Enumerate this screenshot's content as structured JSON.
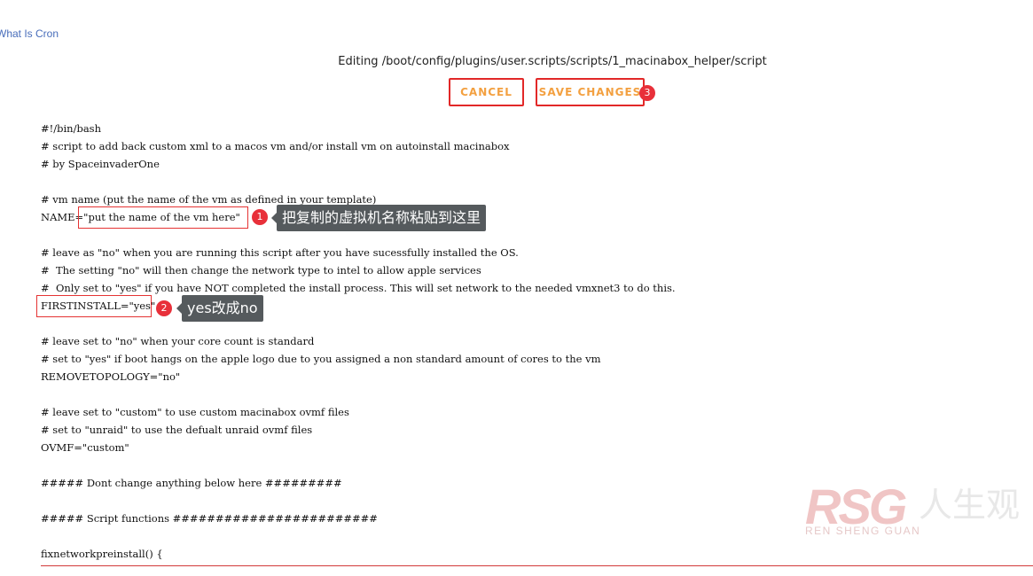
{
  "header": {
    "link_text": "What Is Cron",
    "editing_title": "Editing /boot/config/plugins/user.scripts/scripts/1_macinabox_helper/script"
  },
  "toolbar": {
    "cancel_label": "CANCEL",
    "save_label": "SAVE CHANGES"
  },
  "editor": {
    "lines": [
      "#!/bin/bash",
      "# script to add back custom xml to a macos vm and/or install vm on autoinstall macinabox",
      "# by SpaceinvaderOne",
      "",
      "# vm name (put the name of the vm as defined in your template)",
      "NAME=\"put the name of the vm here\"",
      "",
      "# leave as \"no\" when you are running this script after you have sucessfully installed the OS.",
      "#  The setting \"no\" will then change the network type to intel to allow apple services",
      "#  Only set to \"yes\" if you have NOT completed the install process. This will set network to the needed vmxnet3 to do this.",
      "FIRSTINSTALL=\"yes\"",
      "",
      "# leave set to \"no\" when your core count is standard",
      "# set to \"yes\" if boot hangs on the apple logo due to you assigned a non standard amount of cores to the vm",
      "REMOVETOPOLOGY=\"no\"",
      "",
      "# leave set to \"custom\" to use custom macinabox ovmf files",
      "# set to \"unraid\" to use the defualt unraid ovmf files",
      "OVMF=\"custom\"",
      "",
      "##### Dont change anything below here #########",
      "",
      "##### Script functions ########################",
      "",
      "fixnetworkpreinstall() {"
    ]
  },
  "annotations": {
    "badge_1": "1",
    "tip_1": "把复制的虚拟机名称粘贴到这里",
    "badge_2": "2",
    "tip_2": "yes改成no",
    "badge_3": "3"
  },
  "watermark": {
    "logo_text": "RSG",
    "chinese_text": "人生观",
    "english_text": "REN SHENG GUAN"
  },
  "colors": {
    "accent_orange": "#f3a040",
    "button_border_red": "#e22828",
    "badge_red": "#e8303a",
    "tooltip_gray": "#555a5d",
    "link_blue": "#486dba"
  }
}
